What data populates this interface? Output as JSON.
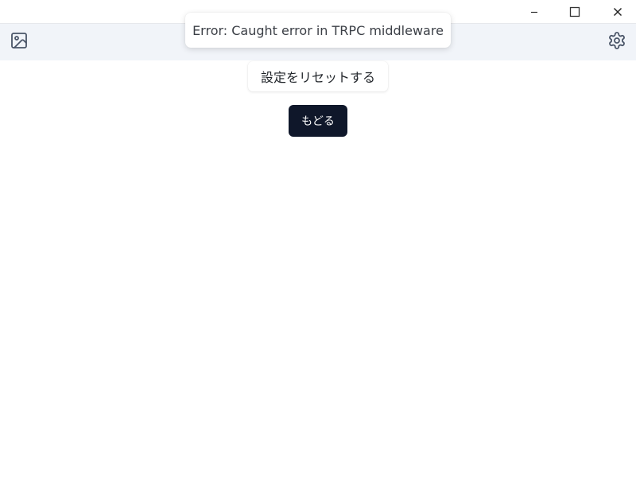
{
  "window": {
    "controls": {
      "minimize_icon": "minimize-icon",
      "maximize_icon": "maximize-icon",
      "close_icon": "close-icon"
    }
  },
  "toolbar": {
    "left_icon": "image-icon",
    "right_icon": "gear-icon",
    "background": "#f1f4f9"
  },
  "toast": {
    "message": "Error: Caught error in TRPC middleware"
  },
  "main": {
    "reset_label": "設定をリセットする",
    "back_label": "もどる",
    "back_button_color": "#0f172a"
  }
}
